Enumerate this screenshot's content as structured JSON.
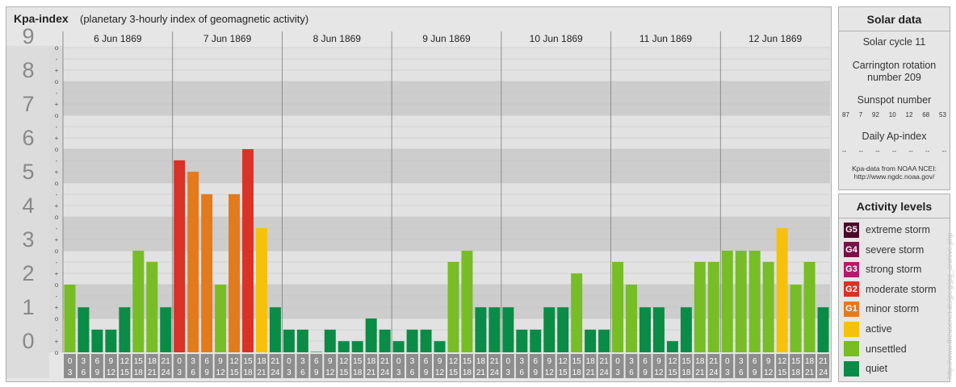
{
  "header": {
    "title": "Kpa-index",
    "subtitle": "(planetary 3-hourly index of geomagnetic activity)"
  },
  "chart_data": {
    "type": "bar",
    "days": [
      "6 Jun 1869",
      "7 Jun 1869",
      "8 Jun 1869",
      "9 Jun 1869",
      "10 Jun 1869",
      "11 Jun 1869",
      "12 Jun 1869"
    ],
    "interval_start_labels": [
      "0",
      "3",
      "6",
      "9",
      "12",
      "15",
      "18",
      "21"
    ],
    "interval_end_labels": [
      "3",
      "6",
      "9",
      "12",
      "15",
      "18",
      "21",
      "24"
    ],
    "y_tick_labels": [
      "0",
      "1",
      "2",
      "3",
      "4",
      "5",
      "6",
      "7",
      "8",
      "9"
    ],
    "y_minor_labels": [
      "+",
      "o",
      "-"
    ],
    "ylim": [
      0,
      9
    ],
    "values": [
      2.0,
      1.33,
      0.67,
      0.67,
      1.33,
      3.0,
      2.67,
      1.33,
      5.67,
      5.33,
      4.67,
      2.0,
      4.67,
      6.0,
      3.67,
      1.33,
      0.67,
      0.67,
      0.0,
      0.67,
      0.33,
      0.33,
      1.0,
      0.67,
      0.33,
      0.67,
      0.67,
      0.33,
      2.67,
      3.0,
      1.33,
      1.33,
      1.33,
      0.67,
      0.67,
      1.33,
      1.33,
      2.33,
      0.67,
      0.67,
      2.67,
      2.0,
      1.33,
      1.33,
      0.33,
      1.33,
      2.67,
      2.67,
      3.0,
      3.0,
      3.0,
      2.67,
      3.67,
      2.0,
      2.67,
      1.33
    ],
    "colors": {
      "quiet": "#0a8c46",
      "unsettled": "#76bd26",
      "active": "#f6c10b",
      "minor": "#e37b1c",
      "moderate": "#d93226",
      "band_dark": "#cdcdcd",
      "band_light": "#e2e2e2",
      "axis_label": "#888888",
      "axis_box": "#8d8d8d"
    }
  },
  "solar": {
    "title": "Solar data",
    "cycle": "Solar cycle 11",
    "carrington_line1": "Carrington rotation",
    "carrington_line2": "number 209",
    "sunspot_label": "Sunspot number",
    "sunspot_values": [
      "87",
      "7",
      "92",
      "10",
      "12",
      "68",
      "53"
    ],
    "ap_label": "Daily Ap-index",
    "ap_values": [
      "--",
      "--",
      "--",
      "--",
      "--",
      "--",
      "--"
    ],
    "credit_line1": "Kpa-data from NOAA NCEI:",
    "credit_line2": "http://www.ngdc.noaa.gov/"
  },
  "activity": {
    "title": "Activity levels",
    "levels": [
      {
        "code": "G5",
        "label": "extreme storm",
        "color": "#4a0a28"
      },
      {
        "code": "G4",
        "label": "severe storm",
        "color": "#7a1048"
      },
      {
        "code": "G3",
        "label": "strong storm",
        "color": "#b8186a"
      },
      {
        "code": "G2",
        "label": "moderate storm",
        "color": "#d93226"
      },
      {
        "code": "G1",
        "label": "minor storm",
        "color": "#e37b1c"
      },
      {
        "code": "",
        "label": "active",
        "color": "#f6c10b"
      },
      {
        "code": "",
        "label": "unsettled",
        "color": "#76bd26"
      },
      {
        "code": "",
        "label": "quiet",
        "color": "#0a8c46"
      }
    ]
  },
  "watermark": "http://www.theusenet.de/jpeg/jpg_archive.php"
}
